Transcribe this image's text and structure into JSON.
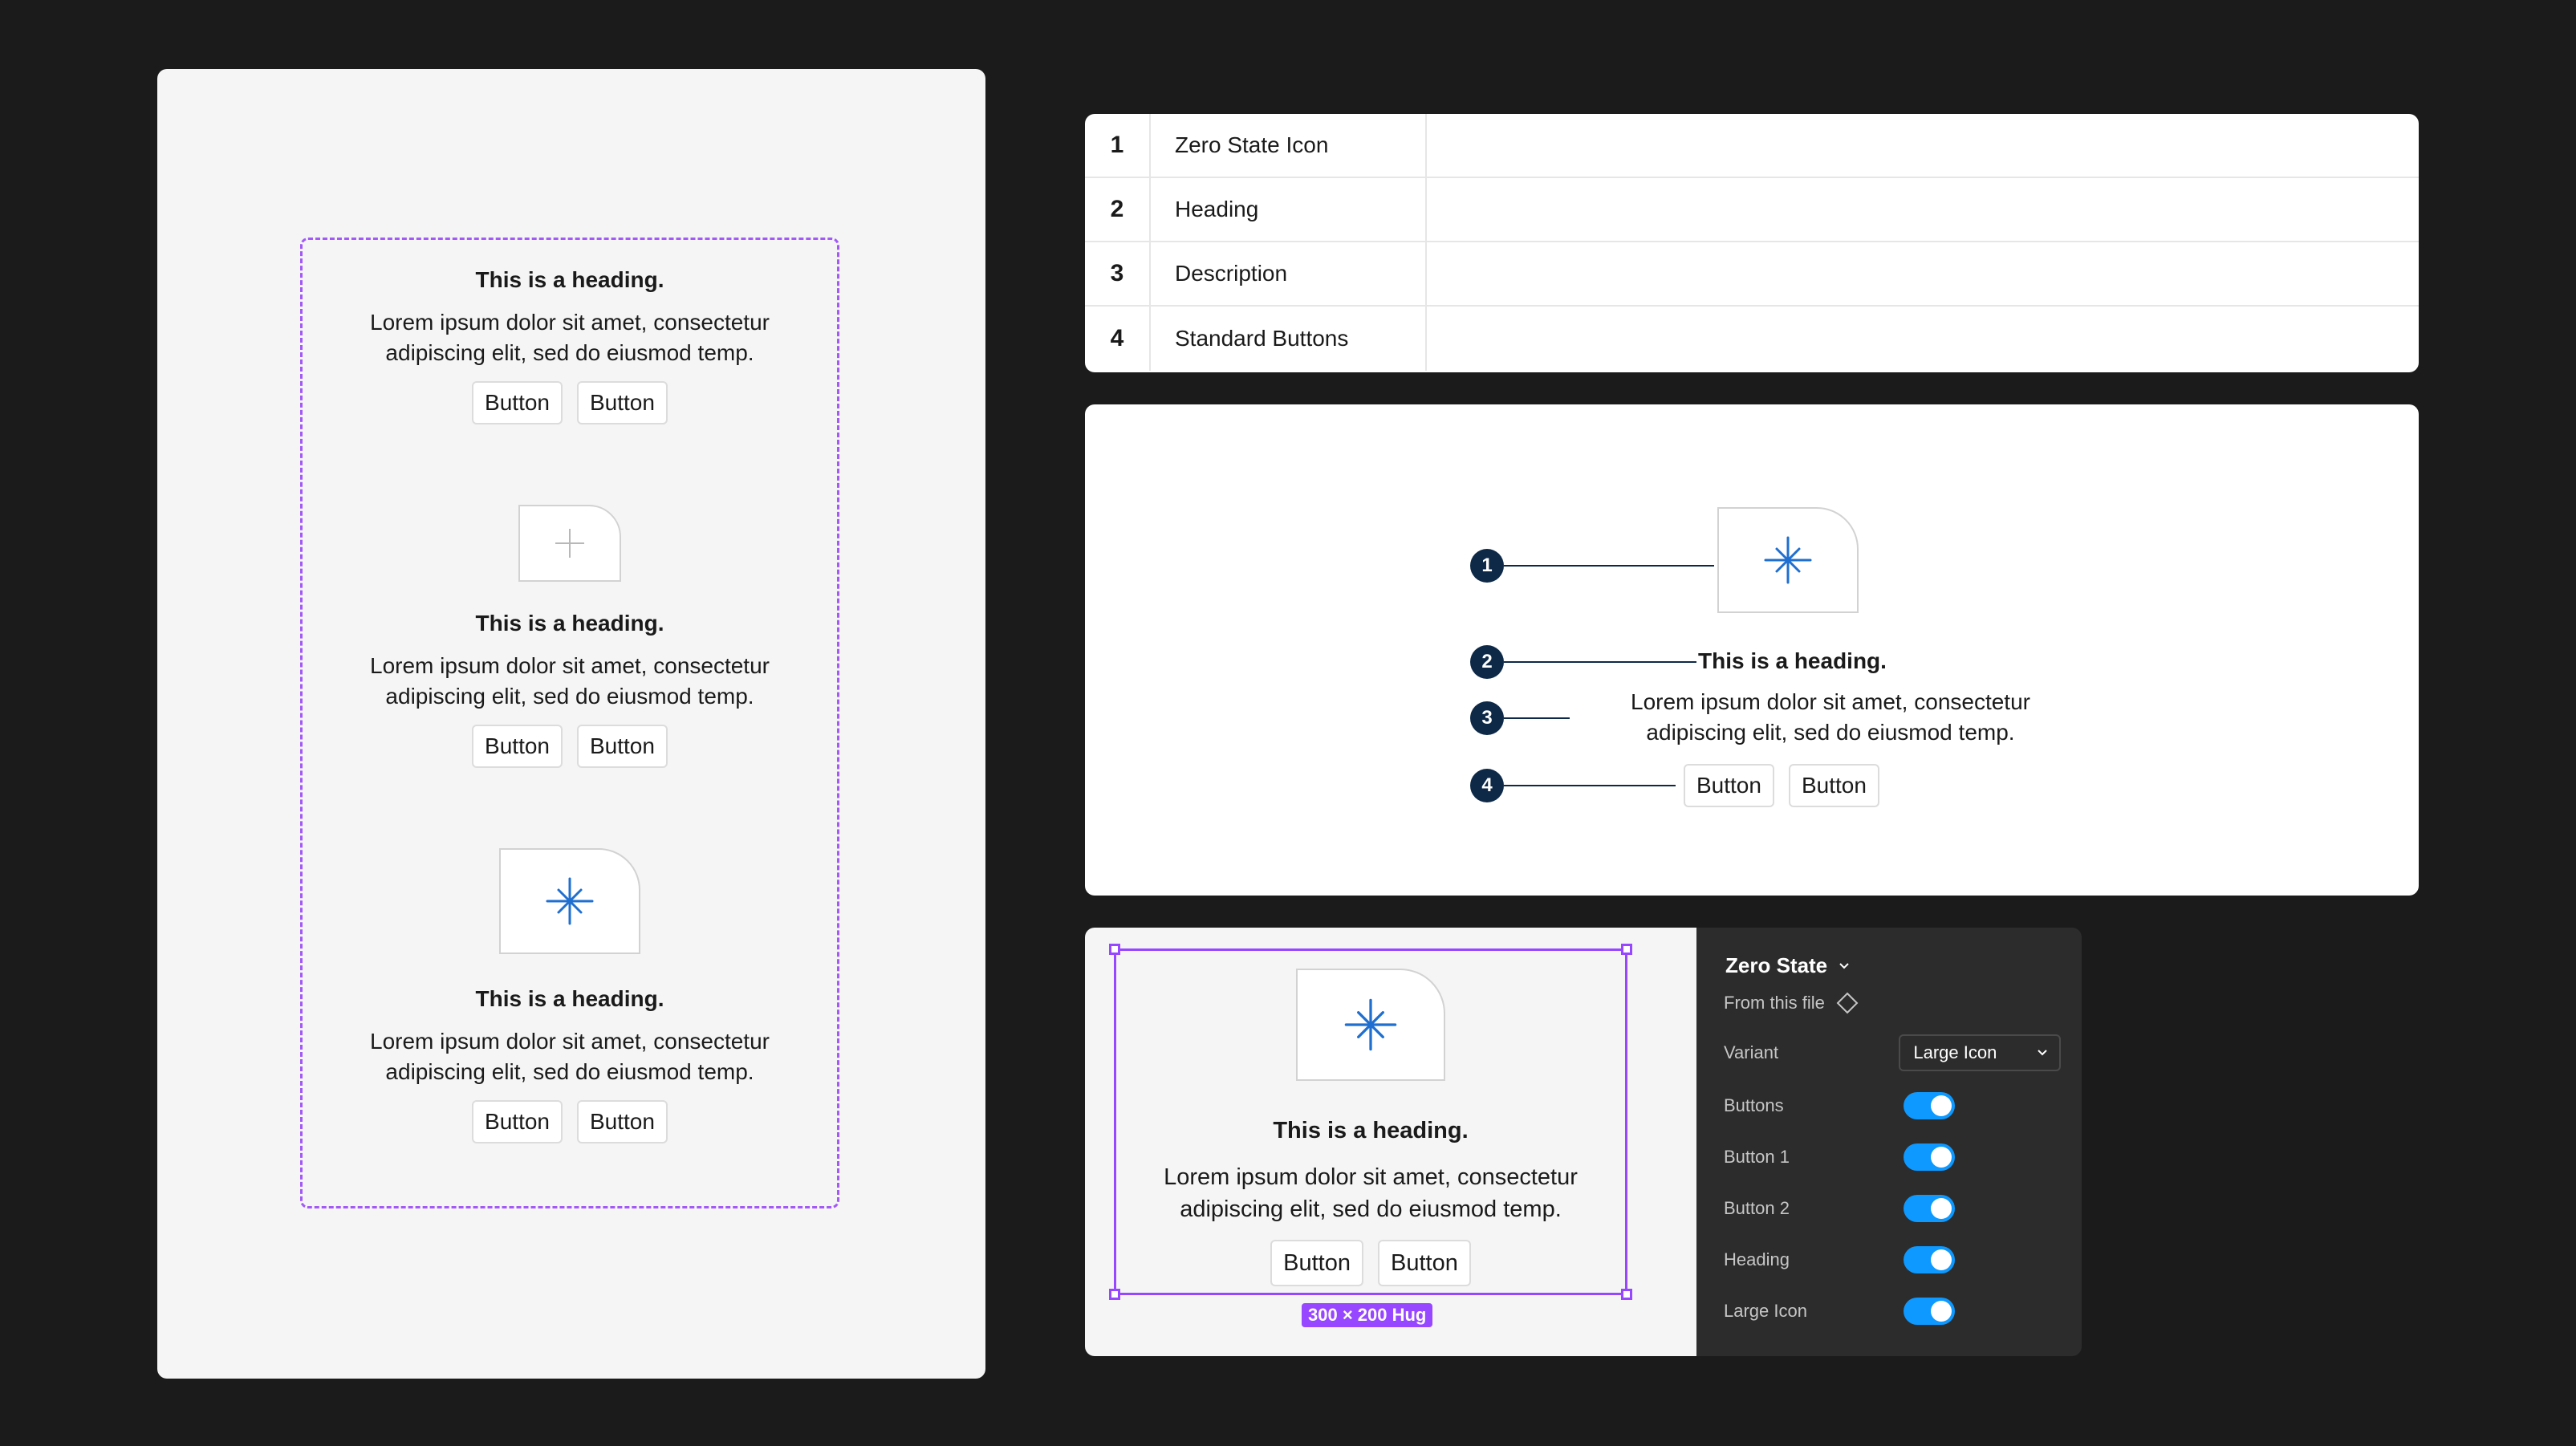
{
  "variants_panel": {
    "items": [
      {
        "heading": "This is a heading.",
        "description": "Lorem ipsum dolor sit amet, consectetur adipiscing elit, sed do eiusmod temp.",
        "button_1": "Button",
        "button_2": "Button"
      },
      {
        "heading": "This is a heading.",
        "description": "Lorem ipsum dolor sit amet, consectetur adipiscing elit, sed do eiusmod temp.",
        "button_1": "Button",
        "button_2": "Button"
      },
      {
        "heading": "This is a heading.",
        "description": "Lorem ipsum dolor sit amet, consectetur adipiscing elit, sed do eiusmod temp.",
        "button_1": "Button",
        "button_2": "Button"
      }
    ]
  },
  "anatomy_table": {
    "rows": [
      {
        "num": "1",
        "label": "Zero State Icon"
      },
      {
        "num": "2",
        "label": "Heading"
      },
      {
        "num": "3",
        "label": "Description"
      },
      {
        "num": "4",
        "label": "Standard Buttons"
      }
    ]
  },
  "anatomy_diagram": {
    "markers": [
      "1",
      "2",
      "3",
      "4"
    ],
    "heading": "This is a heading.",
    "description_line_1": "Lorem ipsum dolor sit amet, consectetur",
    "description_line_2": "adipiscing elit, sed do eiusmod temp.",
    "button_1": "Button",
    "button_2": "Button"
  },
  "preview": {
    "heading": "This is a heading.",
    "description_line_1": "Lorem ipsum dolor sit amet, consectetur",
    "description_line_2": "adipiscing elit, sed do eiusmod temp.",
    "button_1": "Button",
    "button_2": "Button",
    "size_badge": "300 × 200 Hug"
  },
  "properties": {
    "component_name": "Zero State",
    "source": "From this file",
    "variant_label": "Variant",
    "variant_value": "Large Icon",
    "toggles": [
      {
        "label": "Buttons",
        "on": true
      },
      {
        "label": "Button 1",
        "on": true
      },
      {
        "label": "Button 2",
        "on": true
      },
      {
        "label": "Heading",
        "on": true
      },
      {
        "label": "Large Icon",
        "on": true
      }
    ]
  },
  "colors": {
    "background": "#1b1b1b",
    "selection": "#9747ff",
    "dashed_frame": "#a259f7",
    "marker": "#0d2947",
    "icon_blue": "#1f6fd1",
    "toggle_on": "#0d99ff"
  },
  "icons": [
    "plus-icon",
    "sparkle-icon",
    "chevron-down-icon",
    "component-diamond-icon"
  ]
}
